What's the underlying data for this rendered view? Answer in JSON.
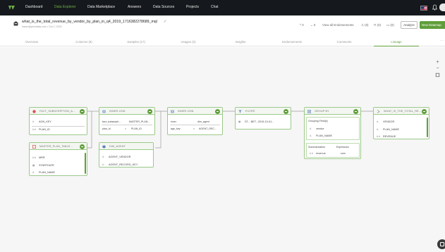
{
  "nav": {
    "items": [
      "Dashboard",
      "Data Explorer",
      "Data Marketplace",
      "Answers",
      "Data Sources",
      "Projects",
      "Chat"
    ],
    "active_index": 1
  },
  "header": {
    "title": "what_is_the_total_revenue_by_vendor_by_plan_in_q4_2019_1716382278689_mql",
    "edit_glyph": "✐",
    "meta": "haser@ymlzdata.com • Oct 2, 2024",
    "up_count": "0",
    "down_count": "0",
    "view_endorsements": "View all Endorsements",
    "users_count": "(0)",
    "lock_count": "(0)",
    "comment_count": "(0)",
    "analyze_label": "Analyze",
    "new_label": "New Datamap"
  },
  "tabs": {
    "items": [
      "Overview",
      "Columns (8)",
      "Samples (17)",
      "Usages (0)",
      "Insights",
      "Endorsements",
      "Comments",
      "Lineage"
    ],
    "active_index": 7,
    "more": "···"
  },
  "canvas": {
    "zoom_in": "+",
    "zoom_out": "−"
  },
  "nodes": {
    "fact": {
      "title": "FACT_SUBSCRIPTION_A...",
      "fields": [
        {
          "icon": "#",
          "name": "AGN_KEY"
        },
        {
          "icon": "#.#",
          "name": "PLAN_ID"
        }
      ]
    },
    "master_plan": {
      "title": "MASTER_PLAN_TABLE...",
      "fields": [
        {
          "icon": "#.#",
          "name": "MRR"
        },
        {
          "icon": "▦",
          "name": "STARTDATE"
        },
        {
          "icon": "A",
          "name": "PLAN_NAME"
        }
      ]
    },
    "join1": {
      "title": "INNER JOIN",
      "left_header": "fact_subscripti...",
      "right_header": "MASTER_PLAN...",
      "left_key": "plan_id",
      "op": "=",
      "right_key": "PLAN_ID"
    },
    "dim_agent": {
      "title": "DIM_AGENT",
      "fields": [
        {
          "icon": "A",
          "name": "AGENT_VENDOR"
        },
        {
          "icon": "#",
          "name": "AGENT_RECORD_KEY"
        }
      ]
    },
    "join2": {
      "title": "INNER JOIN",
      "left_header": "inner",
      "right_header": "dim_agent",
      "left_key": "agn_key",
      "op": "=",
      "right_key": "AGENT_REC..."
    },
    "filter": {
      "title": "FILTER",
      "condition": "ST... BET...2019-10-01..."
    },
    "group_by": {
      "title": "GROUP BY",
      "grouping_label": "Grouping Field(s)",
      "grouping_fields": [
        "vendor",
        "PLAN_NAME"
      ],
      "summarization_label": "Summarization",
      "expression_label": "Expression",
      "summary_field": "revenue",
      "summary_expr": "sum"
    },
    "output": {
      "title": "WHAT_IS_THE_TOTAL_RE...",
      "fields": [
        {
          "icon": "A",
          "name": "VENDOR"
        },
        {
          "icon": "A",
          "name": "PLAN_NAME"
        },
        {
          "icon": "#.#",
          "name": "REVENUE"
        }
      ]
    }
  },
  "colors": {
    "accent": "#5f9e3a",
    "node_border": "#9cc98a",
    "nav_bg": "#15181c",
    "canvas_bg": "#f6f6f6"
  }
}
